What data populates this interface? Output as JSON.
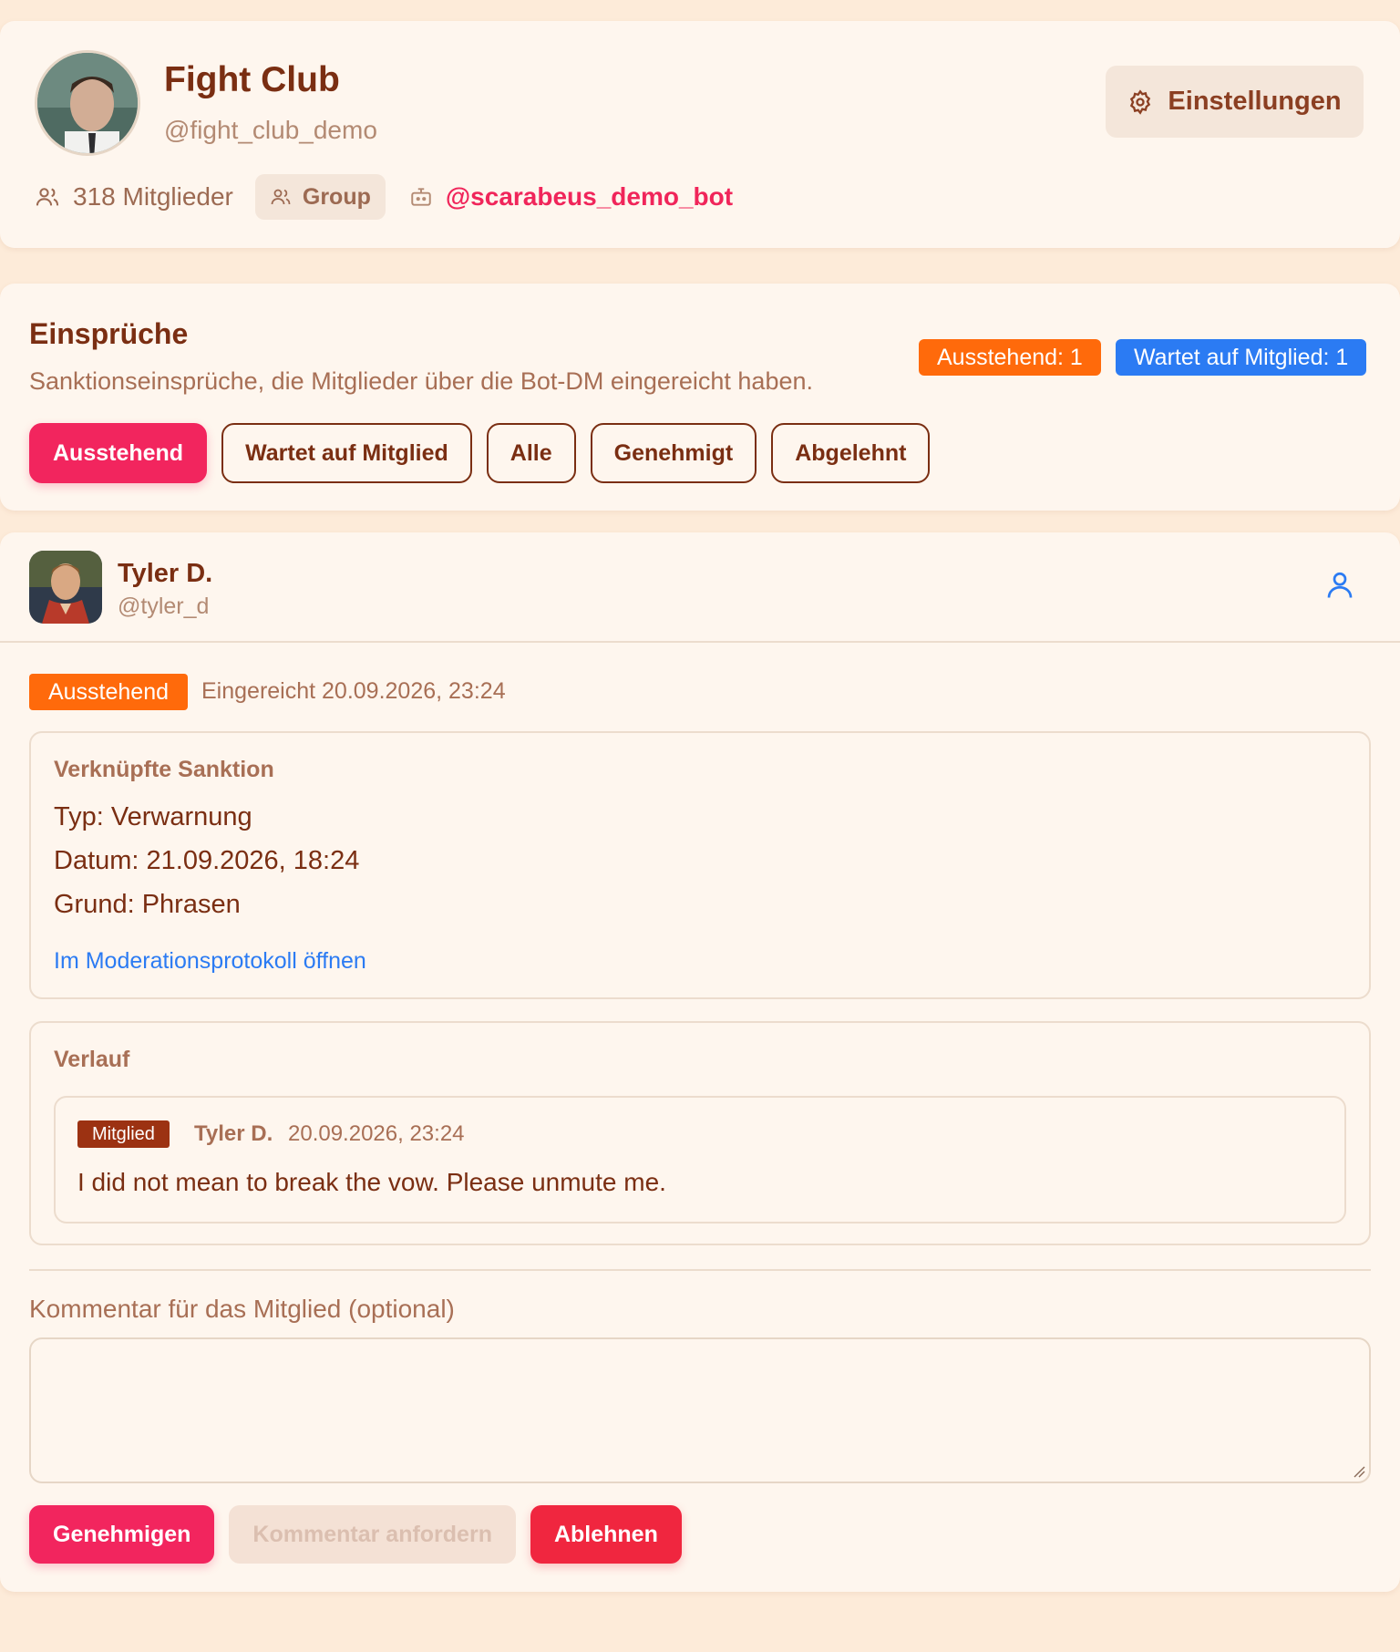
{
  "header": {
    "title": "Fight Club",
    "handle": "@fight_club_demo",
    "settings_label": "Einstellungen",
    "members": "318 Mitglieder",
    "chat_type": "Group",
    "bot": "@scarabeus_demo_bot"
  },
  "appeals": {
    "title": "Einsprüche",
    "subtitle": "Sanktionseinsprüche, die Mitglieder über die Bot-DM eingereicht haben.",
    "badges": {
      "pending": "Ausstehend: 1",
      "waiting": "Wartet auf Mitglied: 1"
    },
    "filters": [
      "Ausstehend",
      "Wartet auf Mitglied",
      "Alle",
      "Genehmigt",
      "Abgelehnt"
    ]
  },
  "detail": {
    "user_name": "Tyler D.",
    "user_handle": "@tyler_d",
    "status": "Ausstehend",
    "submitted": "Eingereicht 20.09.2026, 23:24",
    "sanction": {
      "title": "Verknüpfte Sanktion",
      "type": "Typ: Verwarnung",
      "date": "Datum: 21.09.2026, 18:24",
      "reason": "Grund: Phrasen",
      "link": "Im Moderationsprotokoll öffnen"
    },
    "history": {
      "title": "Verlauf",
      "role": "Mitglied",
      "author": "Tyler D.",
      "time": "20.09.2026, 23:24",
      "text": "I did not mean to break the vow. Please unmute me."
    },
    "comment_label": "Kommentar für das Mitglied (optional)",
    "comment_value": "",
    "actions": {
      "approve": "Genehmigen",
      "request": "Kommentar anfordern",
      "reject": "Ablehnen"
    }
  },
  "colors": {
    "accent": "#f2255e",
    "pending": "#ff6a0b",
    "info": "#2b7bf3",
    "text": "#7a2e12"
  }
}
